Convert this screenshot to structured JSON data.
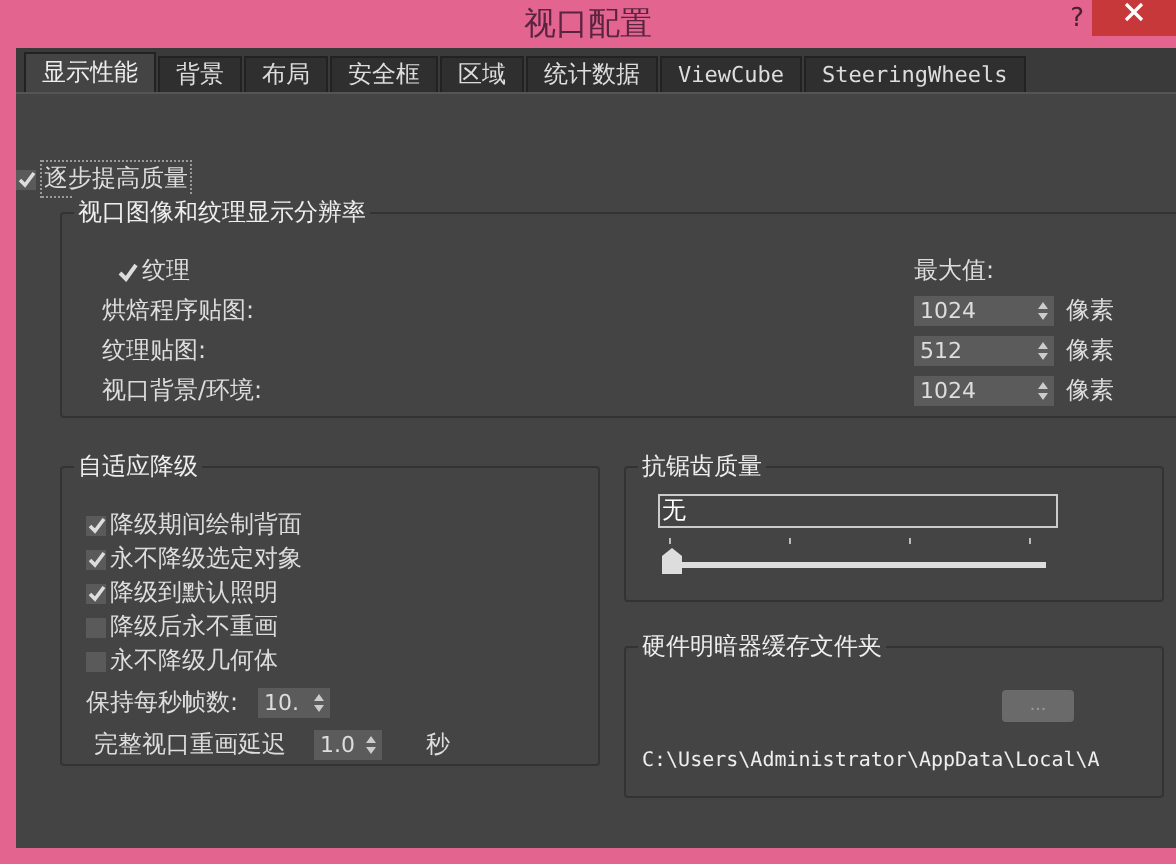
{
  "window": {
    "title": "视口配置",
    "help": "?"
  },
  "tabs": [
    {
      "label": "显示性能",
      "selected": true
    },
    {
      "label": "背景",
      "selected": false
    },
    {
      "label": "布局",
      "selected": false
    },
    {
      "label": "安全框",
      "selected": false
    },
    {
      "label": "区域",
      "selected": false
    },
    {
      "label": "统计数据",
      "selected": false
    },
    {
      "label": "ViewCube",
      "selected": false
    },
    {
      "label": "SteeringWheels",
      "selected": false
    }
  ],
  "progressive": {
    "label": "逐步提高质量",
    "checked": true
  },
  "resolution_group": {
    "title": "视口图像和纹理显示分辨率",
    "texture": {
      "label": "纹理",
      "checked": true
    },
    "max_label": "最大值:",
    "rows": [
      {
        "label": "烘焙程序贴图:",
        "value": "1024",
        "unit": "像素"
      },
      {
        "label": "纹理贴图:",
        "value": "512",
        "unit": "像素"
      },
      {
        "label": "视口背景/环境:",
        "value": "1024",
        "unit": "像素"
      }
    ]
  },
  "adaptive_group": {
    "title": "自适应降级",
    "options": [
      {
        "label": "降级期间绘制背面",
        "checked": true
      },
      {
        "label": "永不降级选定对象",
        "checked": true
      },
      {
        "label": "降级到默认照明",
        "checked": true
      },
      {
        "label": "降级后永不重画",
        "checked": false
      },
      {
        "label": "永不降级几何体",
        "checked": false
      }
    ],
    "fps": {
      "label": "保持每秒帧数:",
      "value": "10."
    },
    "delay": {
      "label": "完整视口重画延迟",
      "value": "1.0",
      "unit": "秒"
    }
  },
  "antialias_group": {
    "title": "抗锯齿质量",
    "value": "无",
    "level": 0
  },
  "shader_group": {
    "title": "硬件明暗器缓存文件夹",
    "browse": {
      "label": "...",
      "disabled": true
    },
    "path": "C:\\Users\\Administrator\\AppData\\Local\\A"
  }
}
